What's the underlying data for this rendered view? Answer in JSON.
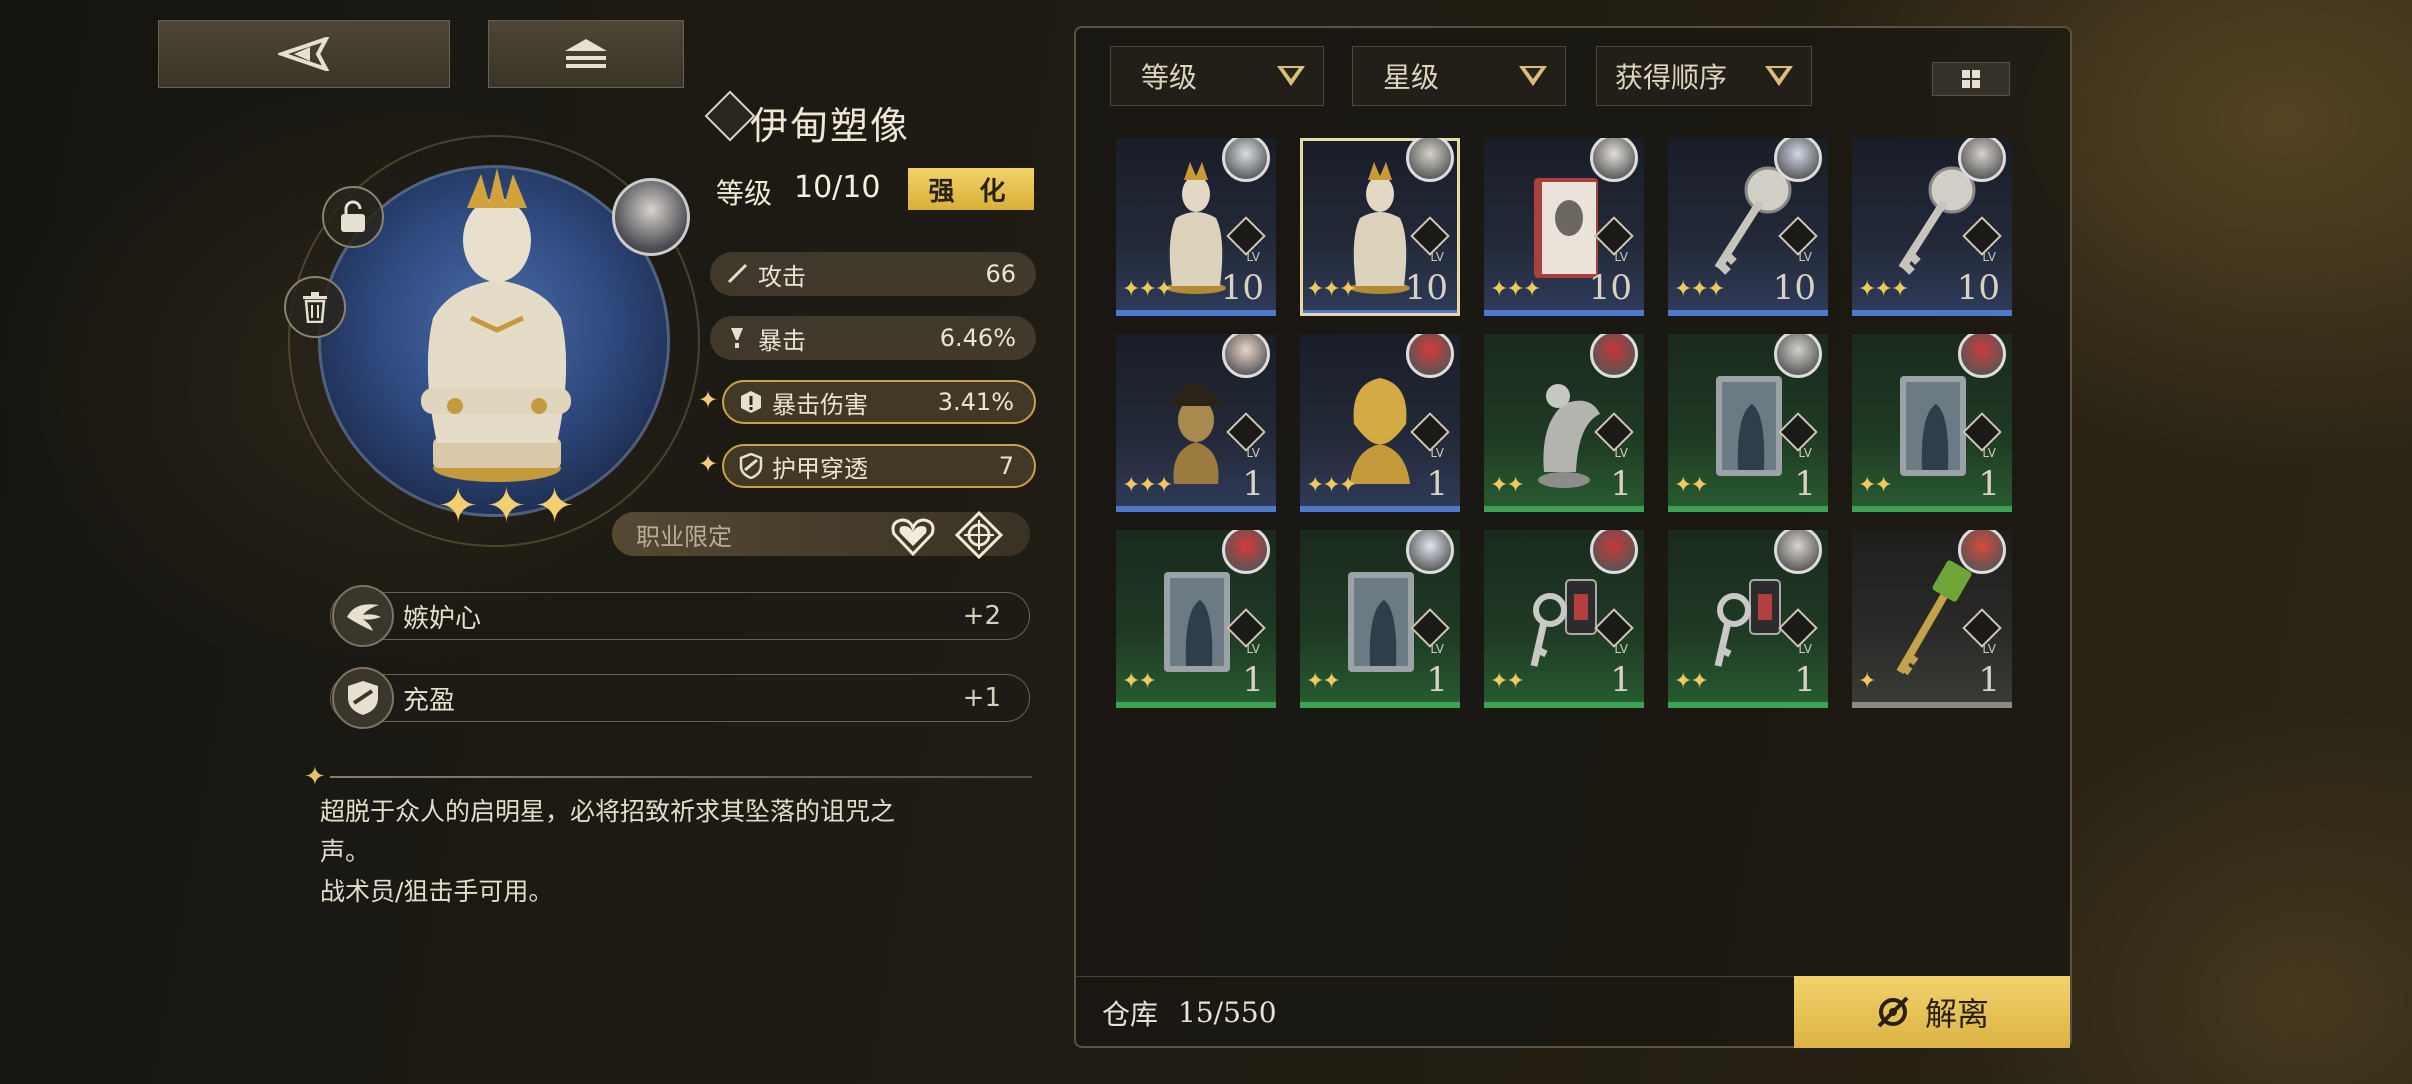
{
  "topbar": {
    "back_icon": "back-arrow-icon",
    "menu_icon": "home-stack-icon"
  },
  "equipment": {
    "name": "伊甸塑像",
    "level_label": "等级",
    "level_value": "10/10",
    "enhance_label": "强 化",
    "stats": [
      {
        "label": "攻击",
        "value": "66",
        "icon": "sword-icon",
        "highlight": false
      },
      {
        "label": "暴击",
        "value": "6.46%",
        "icon": "crit-icon",
        "highlight": false
      },
      {
        "label": "暴击伤害",
        "value": "3.41%",
        "icon": "crit-damage-icon",
        "highlight": true
      },
      {
        "label": "护甲穿透",
        "value": "7",
        "icon": "armor-pierce-icon",
        "highlight": true
      }
    ],
    "job_label": "职业限定",
    "skills": [
      {
        "name": "嫉妒心",
        "points": "+2"
      },
      {
        "name": "充盈",
        "points": "+1"
      }
    ],
    "description_line1": "超脱于众人的启明星，必将招致祈求其坠落的诅咒之",
    "description_line2": "声。",
    "description_line3": "战术员/狙击手可用。"
  },
  "inventory": {
    "sort_level": "等级",
    "sort_star": "星级",
    "sort_order": "获得顺序",
    "items": [
      {
        "level": "10",
        "rarity": "blue",
        "stars": 3,
        "art": "statue"
      },
      {
        "level": "10",
        "rarity": "blue",
        "stars": 3,
        "art": "statue",
        "selected": true
      },
      {
        "level": "10",
        "rarity": "blue",
        "stars": 3,
        "art": "book"
      },
      {
        "level": "10",
        "rarity": "blue",
        "stars": 3,
        "art": "key"
      },
      {
        "level": "10",
        "rarity": "blue",
        "stars": 3,
        "art": "key"
      },
      {
        "level": "1",
        "rarity": "blue",
        "stars": 3,
        "art": "bust"
      },
      {
        "level": "1",
        "rarity": "blue",
        "stars": 3,
        "art": "gold-bust"
      },
      {
        "level": "1",
        "rarity": "green",
        "stars": 2,
        "art": "bird"
      },
      {
        "level": "1",
        "rarity": "green",
        "stars": 2,
        "art": "card"
      },
      {
        "level": "1",
        "rarity": "green",
        "stars": 2,
        "art": "card"
      },
      {
        "level": "1",
        "rarity": "green",
        "stars": 2,
        "art": "card"
      },
      {
        "level": "1",
        "rarity": "green",
        "stars": 2,
        "art": "card"
      },
      {
        "level": "1",
        "rarity": "green",
        "stars": 2,
        "art": "keychain"
      },
      {
        "level": "1",
        "rarity": "green",
        "stars": 2,
        "art": "keychain"
      },
      {
        "level": "1",
        "rarity": "gray",
        "stars": 1,
        "art": "green-key"
      }
    ],
    "lv_label": "LV",
    "storage_label": "仓库",
    "storage_value": "15/550",
    "dismantle_label": "解离"
  },
  "colors": {
    "accent": "#e3bd4e",
    "blue_rarity": "#4e78c9",
    "green_rarity": "#3aa454",
    "gray_rarity": "#8b8b84"
  }
}
